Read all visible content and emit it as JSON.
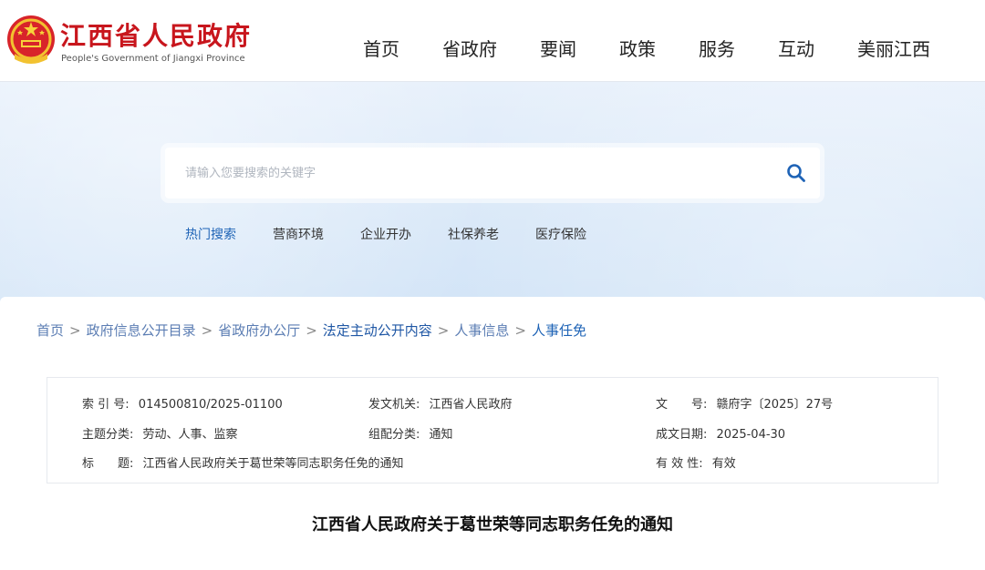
{
  "header": {
    "logo_cn": "江西省人民政府",
    "logo_en": "People's Government of Jiangxi Province",
    "nav": [
      "首页",
      "省政府",
      "要闻",
      "政策",
      "服务",
      "互动",
      "美丽江西"
    ]
  },
  "search": {
    "placeholder": "请输入您要搜索的关键字",
    "hot_label": "热门搜索",
    "hot_items": [
      "营商环境",
      "企业开办",
      "社保养老",
      "医疗保险"
    ]
  },
  "breadcrumb": [
    "首页",
    "政府信息公开目录",
    "省政府办公厅",
    "法定主动公开内容",
    "人事信息",
    "人事任免"
  ],
  "meta": {
    "index_label": "索 引 号:",
    "index_value": "014500810/2025-01100",
    "issuer_label": "发文机关:",
    "issuer_value": "江西省人民政府",
    "doc_no_label": "文　　号:",
    "doc_no_value": "赣府字〔2025〕27号",
    "topic_label": "主题分类:",
    "topic_value": "劳动、人事、监察",
    "form_label": "组配分类:",
    "form_value": "通知",
    "date_label": "成文日期:",
    "date_value": "2025-04-30",
    "title_label": "标　　题:",
    "title_value": "江西省人民政府关于葛世荣等同志职务任免的通知",
    "valid_label": "有 效 性:",
    "valid_value": "有效"
  },
  "article_title": "江西省人民政府关于葛世荣等同志职务任免的通知",
  "colors": {
    "brand_red": "#c8161d",
    "link_blue": "#1e63b6"
  }
}
